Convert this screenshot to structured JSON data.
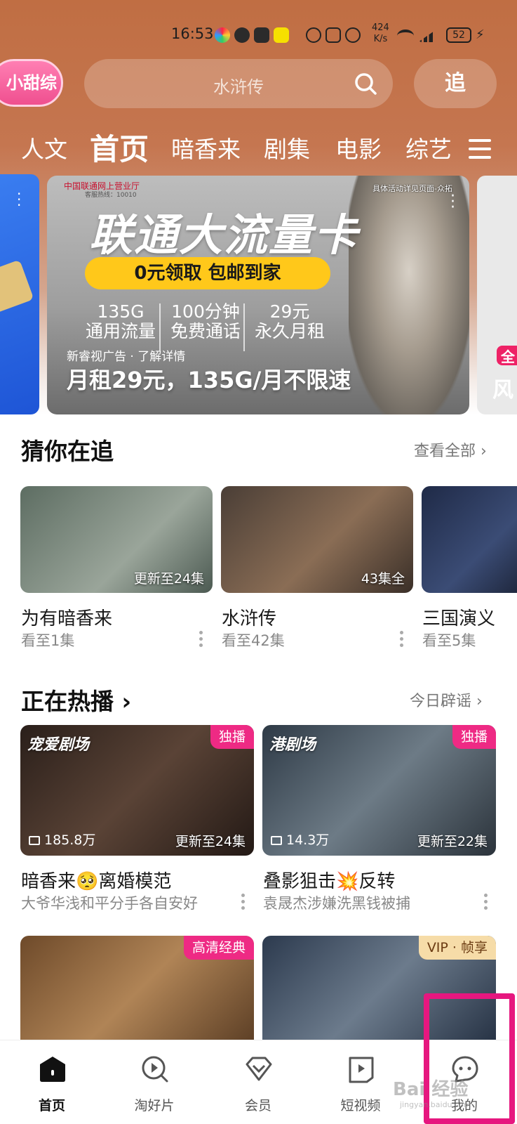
{
  "status_bar": {
    "time": "16:53",
    "speed_value": "424",
    "speed_unit": "K/s",
    "battery": "52"
  },
  "header": {
    "brand_label": "小甜综",
    "search_placeholder": "水浒传",
    "chase_label": "追"
  },
  "tabs": [
    "人文",
    "首页",
    "暗香来",
    "剧集",
    "电影",
    "综艺"
  ],
  "active_tab": "首页",
  "banner": {
    "logo_text": "中国联通网上营业厅",
    "hotline": "客服热线：10010",
    "corner_note": "具体活动详见页面-众拓",
    "headline": "联通大流量卡",
    "cta": "0元领取 包邮到家",
    "stats": [
      {
        "top": "135G",
        "bottom": "通用流量"
      },
      {
        "top": "100分钟",
        "bottom": "免费通话"
      },
      {
        "top": "29元",
        "bottom": "永久月租"
      }
    ],
    "ad_line": "新睿视广告 · 了解详情",
    "bottom_text": "月租29元，135G/月不限速"
  },
  "peek_right": {
    "tag": "全",
    "text": "风"
  },
  "guess": {
    "title": "猜你在追",
    "more": "查看全部",
    "items": [
      {
        "title": "为有暗香来",
        "progress": "看至1集",
        "overlay": "更新至24集",
        "bg": "#6f7a70"
      },
      {
        "title": "水浒传",
        "progress": "看至42集",
        "overlay": "43集全",
        "bg": "#6b5a4a"
      },
      {
        "title": "三国演义",
        "progress": "看至5集",
        "overlay": "",
        "bg": "#2d3a5a"
      }
    ]
  },
  "hot": {
    "title": "正在热播",
    "more": "今日辟谣",
    "items": [
      {
        "logo": "宠爱剧场",
        "badge": "独播",
        "views": "185.8万",
        "update": "更新至24集",
        "title": "暗香来🥺离婚模范",
        "desc": "大爷华浅和平分手各自安好",
        "bg": "#3a2c25"
      },
      {
        "logo": "港剧场",
        "badge": "独播",
        "views": "14.3万",
        "update": "更新至22集",
        "title": "叠影狙击💥反转",
        "desc": "袁晟杰涉嫌洗黑钱被捕",
        "bg": "#3d4b58"
      },
      {
        "badge": "高清经典",
        "bg": "#7c5a3a"
      },
      {
        "badge": "VIP · 帧享",
        "bg": "#3b4a5e"
      }
    ]
  },
  "bottom_nav": [
    {
      "label": "首页",
      "icon": "home-icon"
    },
    {
      "label": "淘好片",
      "icon": "search-play-icon"
    },
    {
      "label": "会员",
      "icon": "diamond-icon"
    },
    {
      "label": "短视频",
      "icon": "short-video-icon"
    },
    {
      "label": "我的",
      "icon": "profile-chat-icon"
    }
  ],
  "watermark": {
    "main": "Bai 经验",
    "sub": "jingyan.baidu.com"
  },
  "colors": {
    "header_brown": "#c06e43",
    "accent_pink": "#ee2a84",
    "highlight_box": "#e6177f",
    "cta_yellow": "#ffc81a"
  }
}
